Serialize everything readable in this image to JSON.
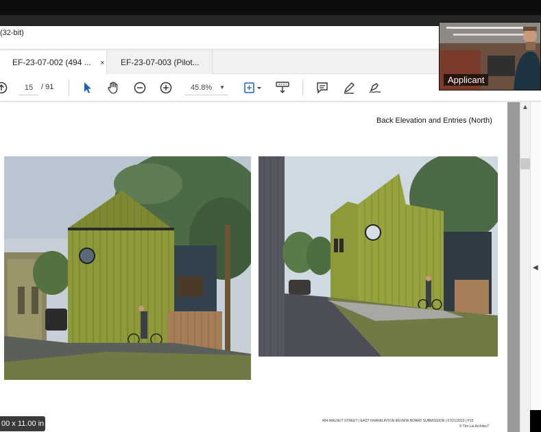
{
  "window": {
    "title": "(32-bit)"
  },
  "tabs": [
    {
      "label": "EF-23-07-002 (494 ...",
      "close": "×",
      "active": true
    },
    {
      "label": "EF-23-07-003 (Pilot...",
      "active": false
    }
  ],
  "toolbar": {
    "page_current": "15",
    "page_total": "/ 91",
    "zoom": "45.8%",
    "icons": [
      "scroll-up-icon",
      "select-arrow-icon",
      "hand-icon",
      "zoom-out-icon",
      "zoom-in-icon",
      "zoom-dropdown-icon",
      "fit-page-icon",
      "scroll-mode-icon",
      "comment-icon",
      "highlight-pen-icon",
      "sign-icon"
    ]
  },
  "webcam": {
    "label": "Applicant"
  },
  "document": {
    "heading": "Back Elevation and Entries (North)",
    "footer": "494 WALNUT STREET | EAST FRANKLINTON REVIEW BOARD SUBMISSION | 07/21/2023 | P15",
    "credit": "© Tim Lai ArchitecT"
  },
  "status": {
    "page_size": "00 x 11.00 in"
  },
  "colors": {
    "siding": "#8e9a3a",
    "sky": "#c9d3dc",
    "tree": "#5d7650",
    "grass": "#6f7a45",
    "path": "#505050"
  }
}
